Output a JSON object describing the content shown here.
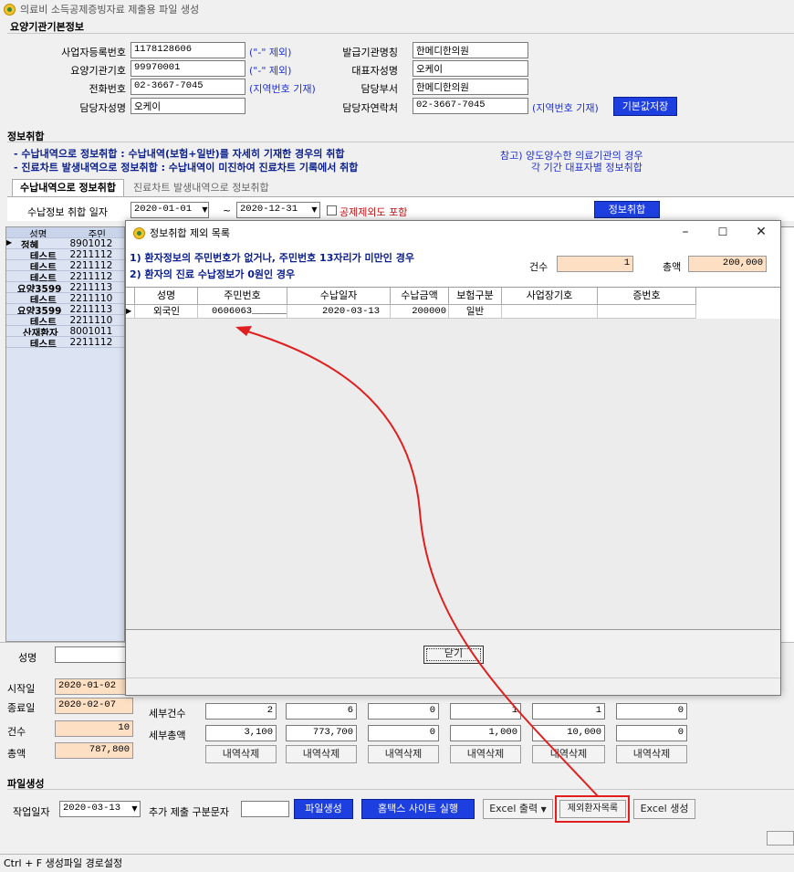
{
  "window": {
    "title": "의료비 소득공제증빙자료 제출용 파일 생성"
  },
  "basic": {
    "section_title": "요양기관기본정보",
    "biz_no_label": "사업자등록번호",
    "biz_no": "1178128606",
    "biz_no_hint": "(\"-\" 제외)",
    "inst_code_label": "요양기관기호",
    "inst_code": "99970001",
    "inst_code_hint": "(\"-\" 제외)",
    "phone_label": "전화번호",
    "phone": "02-3667-7045",
    "phone_hint": "(지역번호 기재)",
    "manager_label": "담당자성명",
    "manager": "오케이",
    "issuer_label": "발급기관명칭",
    "issuer": "한메디한의원",
    "rep_label": "대표자성명",
    "rep": "오케이",
    "dept_label": "담당부서",
    "dept": "한메디한의원",
    "contact_label": "담당자연락처",
    "contact": "02-3667-7045",
    "contact_hint": "(지역번호 기재)",
    "save_default_label": "기본값저장"
  },
  "info": {
    "section_title": "정보취합",
    "line1": "- 수납내역으로 정보취합 : 수납내역(보험+일반)를 자세히 기재한 경우의 취합",
    "line2": "- 진료차트 발생내역으로 정보취합 : 수납내역이 미진하여 진료차트 기록에서 취합",
    "note1": "참고) 양도양수한 의료기관의 경우",
    "note2": "각 기간 대표자별 정보취합",
    "tab1": "수납내역으로 정보취합",
    "tab2": "진료차트 발생내역으로 정보취합",
    "date_label": "수납정보 취합 일자",
    "date_from": "2020-01-01",
    "tilde": "~",
    "date_to": "2020-12-31",
    "include_exempt": "공제제외도 포함",
    "collect_label": "정보취합"
  },
  "left_grid": {
    "headers": [
      "성명",
      "주민"
    ],
    "rows": [
      {
        "name": "정혜",
        "id": "8901012"
      },
      {
        "name": "테스트",
        "id": "2211112"
      },
      {
        "name": "테스트",
        "id": "2211112"
      },
      {
        "name": "테스트",
        "id": "2211112"
      },
      {
        "name": "요양3599",
        "id": "2211113"
      },
      {
        "name": "테스트",
        "id": "2211110"
      },
      {
        "name": "요양3599",
        "id": "2211113"
      },
      {
        "name": "테스트",
        "id": "2211110"
      },
      {
        "name": "산재환자",
        "id": "8001011"
      },
      {
        "name": "테스트",
        "id": "2211112"
      }
    ]
  },
  "summary": {
    "name_label": "성명",
    "start_label": "시작일",
    "start": "2020-01-02",
    "end_label": "종료일",
    "end": "2020-02-07",
    "count_label": "건수",
    "count": "10",
    "total_label": "총액",
    "total": "787,800",
    "detail_count_label": "세부건수",
    "detail_total_label": "세부총액",
    "detail_counts": [
      "2",
      "6",
      "0",
      "1",
      "1",
      "0"
    ],
    "detail_totals": [
      "3,100",
      "773,700",
      "0",
      "1,000",
      "10,000",
      "0"
    ],
    "delete_label": "내역삭제"
  },
  "file": {
    "section_title": "파일생성",
    "work_date_label": "작업일자",
    "work_date": "2020-03-13",
    "extra_label": "추가 제출 구분문자",
    "extra_value": "",
    "gen_label": "파일생성",
    "hometax_label": "홈택스 사이트 실행",
    "excel_out_label": "Excel 출력",
    "excluded_label": "제외환자목록",
    "excel_gen_label": "Excel 생성"
  },
  "dialog": {
    "title": "정보취합 제외 목록",
    "cond1": "1) 환자정보의 주민번호가 없거나, 주민번호 13자리가 미만인 경우",
    "cond2": "2) 환자의 진료 수납정보가 0원인 경우",
    "count_label": "건수",
    "count": "1",
    "total_label": "총액",
    "total": "200,000",
    "headers": [
      "성명",
      "주민번호",
      "수납일자",
      "수납금액",
      "보험구분",
      "사업장기호",
      "증번호"
    ],
    "row": [
      "외국인",
      "0606063______",
      "2020-03-13",
      "200000",
      "일반",
      "",
      ""
    ],
    "close_label": "닫기"
  },
  "statusbar": {
    "text": "Ctrl + F 생성파일 경로설정"
  },
  "colors": {
    "accent_blue": "#1d3fe0",
    "navy": "#0b1f8c",
    "orange_field": "#fde0c4",
    "annotation_red": "#e02020"
  }
}
